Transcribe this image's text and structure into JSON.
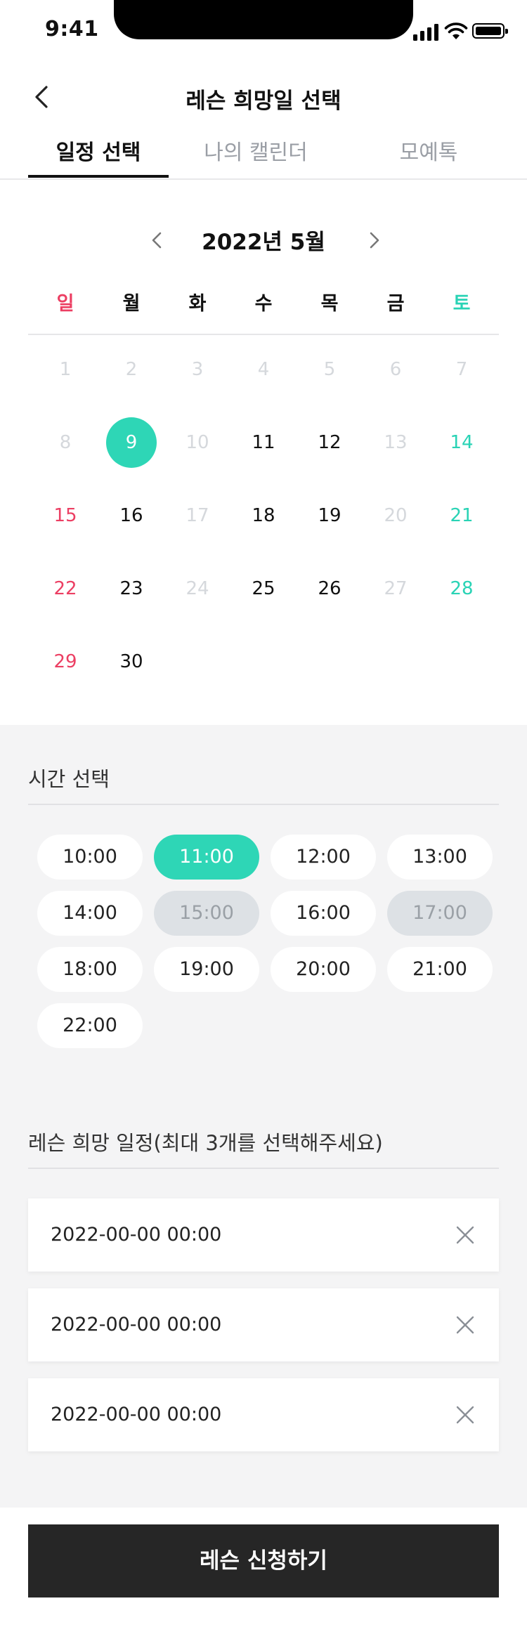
{
  "status_bar": {
    "time": "9:41"
  },
  "header": {
    "title": "레슨 희망일 선택",
    "back_icon": "chevron-left-icon"
  },
  "tabs": [
    {
      "label": "일정 선택",
      "active": true
    },
    {
      "label": "나의 캘린더",
      "active": false
    },
    {
      "label": "모예톡",
      "active": false
    }
  ],
  "calendar": {
    "month_label": "2022년 5월",
    "weekdays": [
      "일",
      "월",
      "화",
      "수",
      "목",
      "금",
      "토"
    ],
    "weeks": [
      [
        {
          "d": "1",
          "state": "disabled"
        },
        {
          "d": "2",
          "state": "disabled"
        },
        {
          "d": "3",
          "state": "disabled"
        },
        {
          "d": "4",
          "state": "disabled"
        },
        {
          "d": "5",
          "state": "disabled"
        },
        {
          "d": "6",
          "state": "disabled"
        },
        {
          "d": "7",
          "state": "disabled"
        }
      ],
      [
        {
          "d": "8",
          "state": "disabled"
        },
        {
          "d": "9",
          "state": "selected"
        },
        {
          "d": "10",
          "state": "disabled"
        },
        {
          "d": "11",
          "state": "normal"
        },
        {
          "d": "12",
          "state": "normal"
        },
        {
          "d": "13",
          "state": "disabled"
        },
        {
          "d": "14",
          "state": "sat"
        }
      ],
      [
        {
          "d": "15",
          "state": "sun"
        },
        {
          "d": "16",
          "state": "normal"
        },
        {
          "d": "17",
          "state": "disabled"
        },
        {
          "d": "18",
          "state": "normal"
        },
        {
          "d": "19",
          "state": "normal"
        },
        {
          "d": "20",
          "state": "disabled"
        },
        {
          "d": "21",
          "state": "sat"
        }
      ],
      [
        {
          "d": "22",
          "state": "sun"
        },
        {
          "d": "23",
          "state": "normal"
        },
        {
          "d": "24",
          "state": "disabled"
        },
        {
          "d": "25",
          "state": "normal"
        },
        {
          "d": "26",
          "state": "normal"
        },
        {
          "d": "27",
          "state": "disabled"
        },
        {
          "d": "28",
          "state": "sat"
        }
      ],
      [
        {
          "d": "29",
          "state": "sun"
        },
        {
          "d": "30",
          "state": "normal"
        }
      ]
    ]
  },
  "time_section": {
    "title": "시간 선택",
    "slots": [
      {
        "t": "10:00",
        "state": "available"
      },
      {
        "t": "11:00",
        "state": "selected"
      },
      {
        "t": "12:00",
        "state": "available"
      },
      {
        "t": "13:00",
        "state": "available"
      },
      {
        "t": "14:00",
        "state": "available"
      },
      {
        "t": "15:00",
        "state": "unavailable"
      },
      {
        "t": "16:00",
        "state": "available"
      },
      {
        "t": "17:00",
        "state": "unavailable"
      },
      {
        "t": "18:00",
        "state": "available"
      },
      {
        "t": "19:00",
        "state": "available"
      },
      {
        "t": "20:00",
        "state": "available"
      },
      {
        "t": "21:00",
        "state": "available"
      },
      {
        "t": "22:00",
        "state": "available"
      }
    ]
  },
  "selection_section": {
    "title": "레슨 희망 일정(최대 3개를 선택해주세요)",
    "items": [
      {
        "text": "2022-00-00 00:00"
      },
      {
        "text": "2022-00-00 00:00"
      },
      {
        "text": "2022-00-00 00:00"
      }
    ],
    "remove_icon": "close-icon"
  },
  "cta": {
    "label": "레슨 신청하기"
  },
  "colors": {
    "accent": "#2ed6b6",
    "sunday": "#ec3f63",
    "saturday": "#29d3b5",
    "disabled": "#d5d8dc",
    "cta_background": "#262626",
    "panel_background": "#f4f4f5"
  }
}
